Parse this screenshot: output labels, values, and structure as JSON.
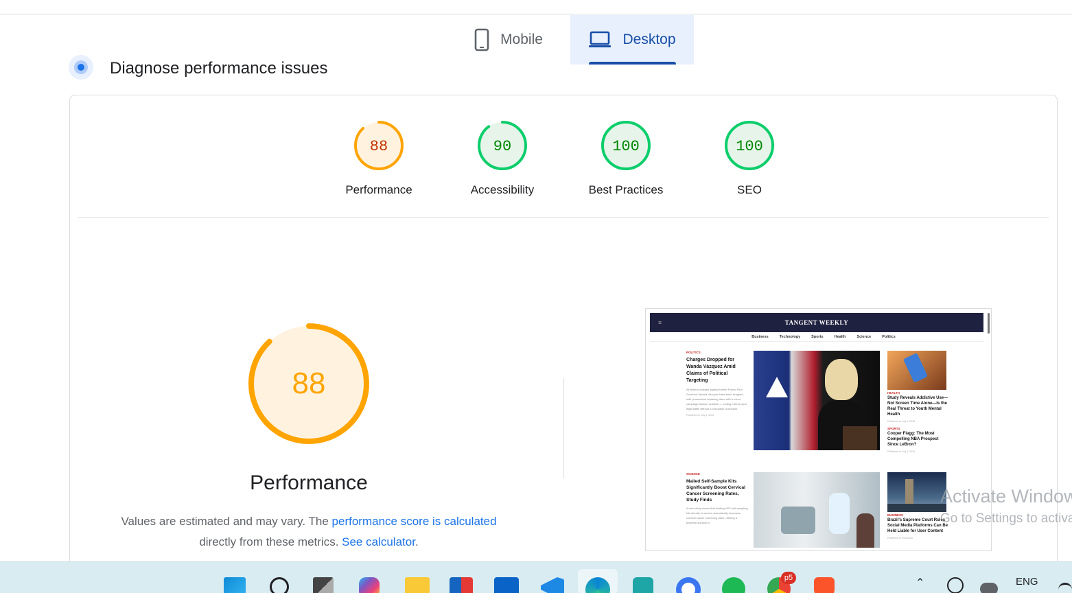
{
  "tabs": [
    {
      "label": "Mobile",
      "icon": "smartphone-icon",
      "active": false
    },
    {
      "label": "Desktop",
      "icon": "laptop-icon",
      "active": true
    }
  ],
  "section": {
    "title": "Diagnose performance issues"
  },
  "scores": [
    {
      "value": "88",
      "label": "Performance",
      "score": 0.88,
      "color": "#ffa400",
      "text_color": "#c33300",
      "fill": "#fff3e0"
    },
    {
      "value": "90",
      "label": "Accessibility",
      "score": 0.9,
      "color": "#0cce6b",
      "text_color": "#008800",
      "fill": "#e6f4ea"
    },
    {
      "value": "100",
      "label": "Best Practices",
      "score": 1.0,
      "color": "#0cce6b",
      "text_color": "#008800",
      "fill": "#e6f4ea"
    },
    {
      "value": "100",
      "label": "SEO",
      "score": 1.0,
      "color": "#0cce6b",
      "text_color": "#008800",
      "fill": "#e6f4ea"
    }
  ],
  "performance": {
    "value": "88",
    "score": 0.88,
    "title": "Performance",
    "note_prefix": "Values are estimated and may vary. The ",
    "note_link": "performance score is calculated",
    "note_middle": " directly from these metrics. ",
    "note_link2": "See calculator",
    "note_suffix": "."
  },
  "screenshot": {
    "masthead": "TANGENT WEEKLY",
    "nav": [
      "Business",
      "Technology",
      "Sports",
      "Health",
      "Science",
      "Politics"
    ],
    "articles": [
      {
        "category": "POLITICS",
        "headline": "Charges Dropped for Wanda Vázquez Amid Claims of Political Targeting",
        "body": "All federal charges against former Puerto Rico Governor Wanda Vázquez have been dropped, with prosecutors replacing them with a minor campaign finance violation — ending a three-year legal battle without a corruption conviction.",
        "date": "Published on July 4, 2025"
      },
      {
        "category": "HEALTH",
        "headline": "Study Reveals Addictive Use—Not Screen Time Alone—Is the Real Threat to Youth Mental Health",
        "date": "Published on July 4, 2025"
      },
      {
        "category": "SPORTS",
        "headline": "Cooper Flagg: The Most Compelling NBA Prospect Since LeBron?",
        "date": "Published on July 3, 2025"
      },
      {
        "category": "SCIENCE",
        "headline": "Mailed Self-Sample Kits Significantly Boost Cervical Cancer Screening Rates, Study Finds",
        "body": "A new study shows that mailing HPV self-sampling kits directly to women dramatically increases cervical cancer screening rates, offering a powerful solution to"
      },
      {
        "category": "BUSINESS",
        "headline": "Brazil's Supreme Court Rules Social Media Platforms Can Be Held Liable for User Content",
        "date": "Published on 6/26/2025"
      }
    ]
  },
  "watermark": {
    "line1": "Activate Windows",
    "line2": "Go to Settings to activate Windows."
  },
  "taskbar": {
    "icons": [
      "windows-start-icon",
      "search-icon",
      "task-view-icon",
      "copilot-icon",
      "file-explorer-icon",
      "microsoft-store-icon",
      "outlook-icon",
      "vscode-icon",
      "edge-icon",
      "surfshark-icon",
      "signal-icon",
      "spotify-icon",
      "chrome-icon",
      "brave-icon"
    ],
    "chrome_badge": "p5",
    "language": "ENG"
  }
}
